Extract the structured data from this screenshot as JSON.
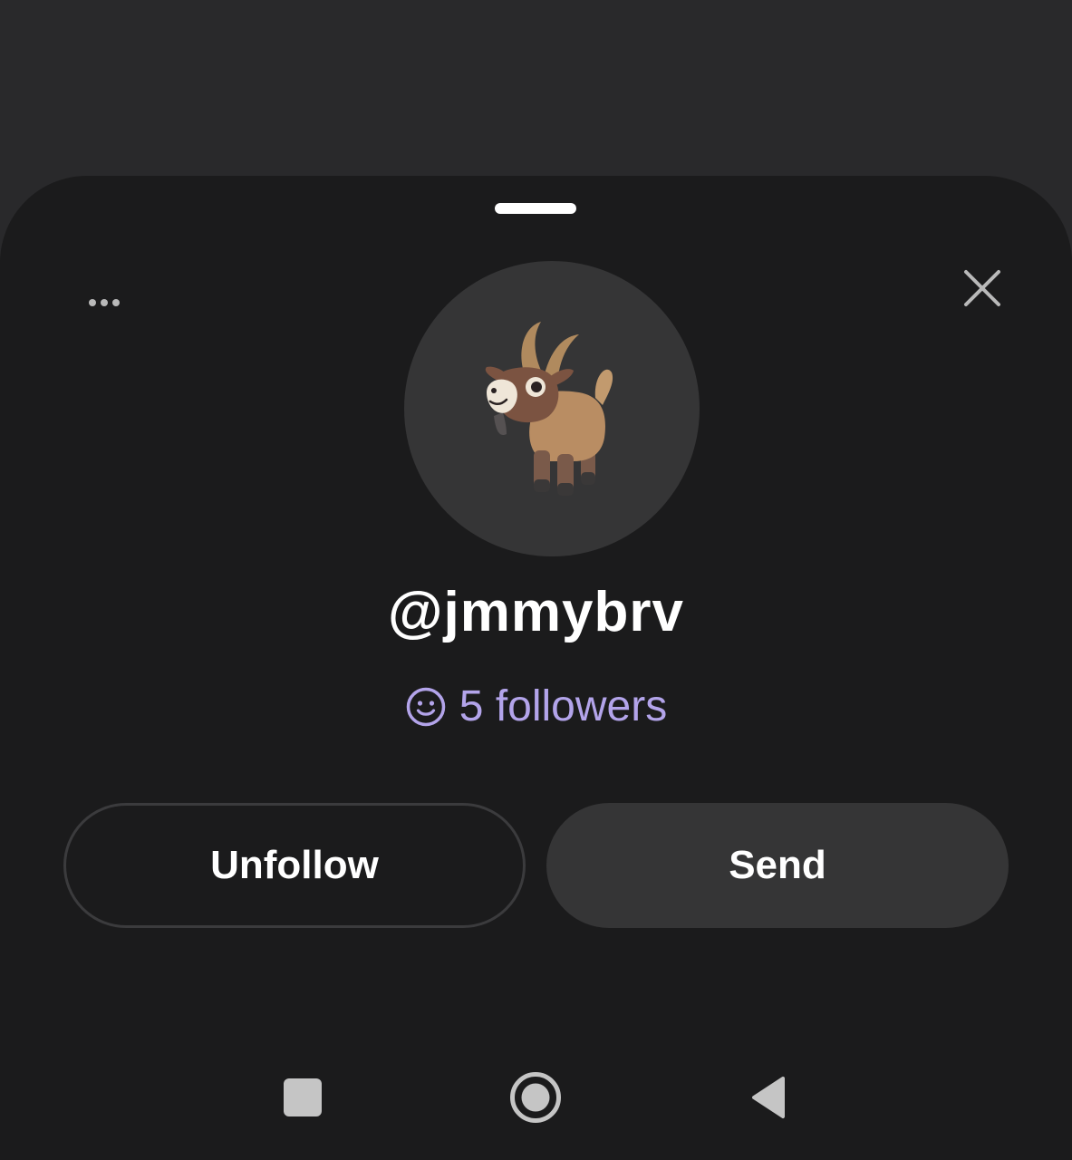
{
  "profile": {
    "username": "@jmmybrv",
    "followers_text": "5 followers",
    "avatar_icon": "goat-emoji"
  },
  "actions": {
    "unfollow_label": "Unfollow",
    "send_label": "Send"
  },
  "icons": {
    "more": "more-horizontal-icon",
    "close": "close-icon",
    "followers": "smile-icon"
  },
  "navigation": {
    "recents": "recents-square-icon",
    "home": "home-circle-icon",
    "back": "back-triangle-icon"
  },
  "colors": {
    "accent": "#b3a4ea",
    "sheet_background": "#1b1b1c",
    "button_fill": "#353536"
  }
}
